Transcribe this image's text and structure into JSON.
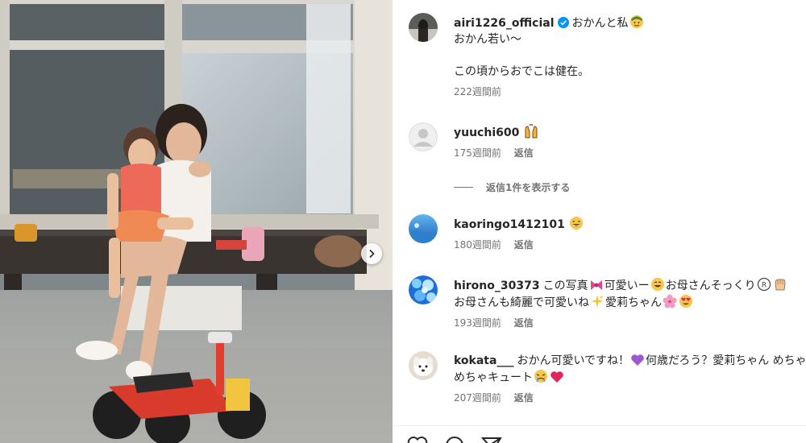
{
  "post": {
    "username": "airi1226_official",
    "verified": true,
    "caption_line1": "おかんと私",
    "caption_line2": "おかん若い〜",
    "caption_line3": "この頃からおでこは健在。",
    "time": "222週間前"
  },
  "comments": [
    {
      "username": "yuuchi600",
      "text": "",
      "emoji": [
        "raising-hands"
      ],
      "time": "175週間前",
      "reply": "返信"
    },
    {
      "username": "kaoringo1412101",
      "text": "",
      "emoji": [
        "laughing-face"
      ],
      "time": "180週間前",
      "reply": "返信"
    },
    {
      "username": "hirono_30373",
      "text_parts": [
        "この写真",
        "可愛いー",
        "お母さんそっくり",
        "",
        "お母さんも綺麗で可愛いね",
        "愛莉ちゃん",
        "",
        ""
      ],
      "time": "193週間前",
      "reply": "返信"
    },
    {
      "username": "kokata___",
      "text_parts": [
        "おかん可愛いですね！",
        "何歳だろう？愛莉ちゃん めちゃめちゃキュート",
        "",
        ""
      ],
      "time": "207週間前",
      "reply": "返信"
    }
  ],
  "view_replies_label": "返信1件を表示する",
  "colors": {
    "text": "#262626",
    "secondary": "#737373",
    "verified": "#0095f6"
  }
}
